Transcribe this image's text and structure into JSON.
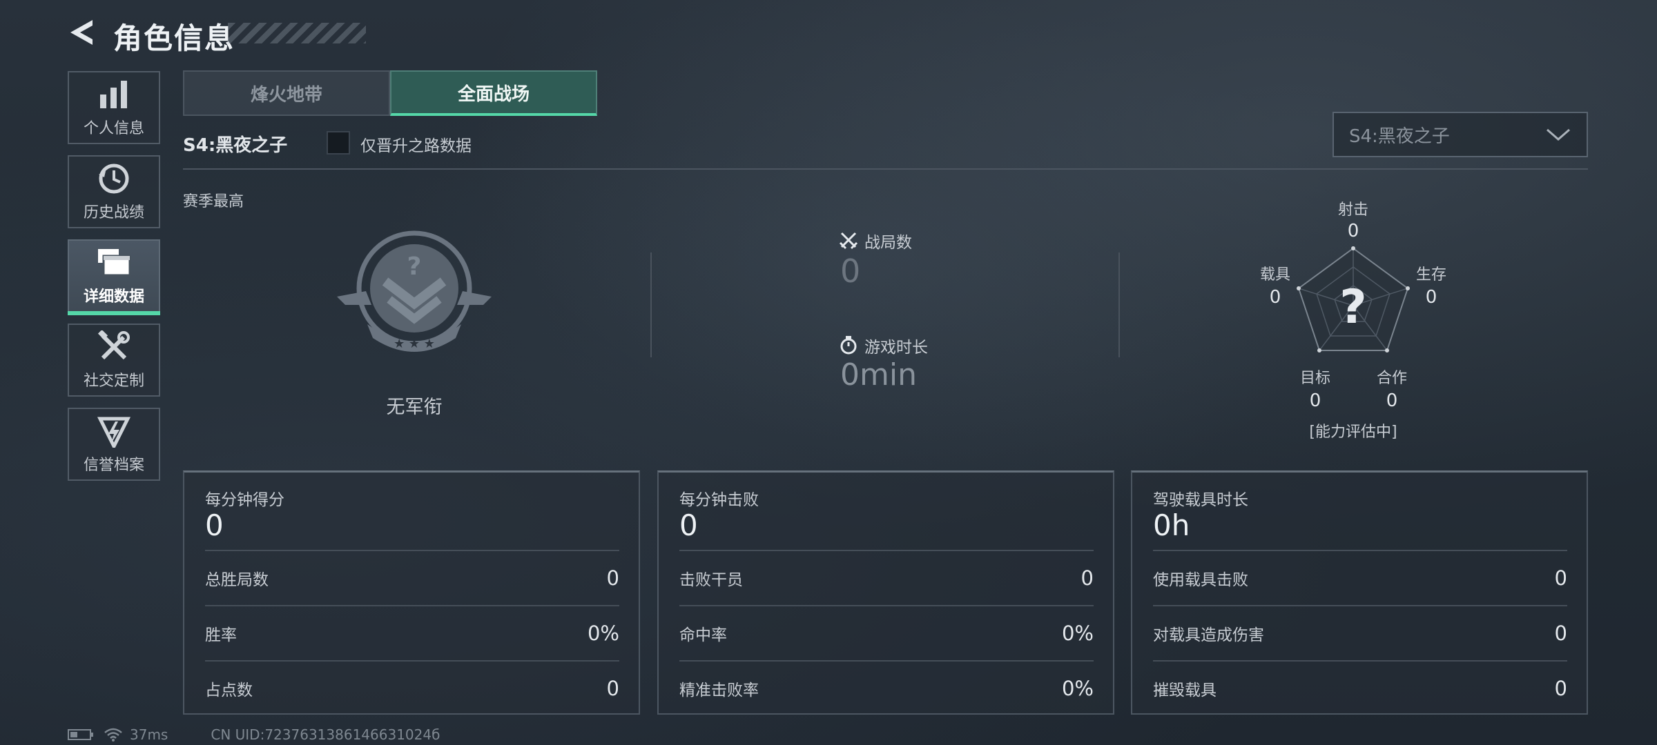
{
  "header": {
    "title": "角色信息"
  },
  "sidebar": {
    "items": [
      {
        "label": "个人信息",
        "icon": "bar-chart-icon"
      },
      {
        "label": "历史战绩",
        "icon": "history-clock-icon"
      },
      {
        "label": "详细数据",
        "icon": "stacked-windows-icon",
        "active": true
      },
      {
        "label": "社交定制",
        "icon": "tools-icon"
      },
      {
        "label": "信誉档案",
        "icon": "credit-emblem-icon"
      }
    ]
  },
  "tabs": [
    {
      "label": "烽火地带",
      "active": false
    },
    {
      "label": "全面战场",
      "active": true
    }
  ],
  "season": {
    "label": "S4:黑夜之子",
    "checkbox_label": "仅晋升之路数据",
    "checkbox_checked": false,
    "dropdown_value": "S4:黑夜之子"
  },
  "best": {
    "label": "赛季最高",
    "rank_label": "无军衔",
    "matches_label": "战局数",
    "matches_value": "0",
    "time_label": "游戏时长",
    "time_value": "0min"
  },
  "radar": {
    "top": {
      "label": "射击",
      "value": "0"
    },
    "right": {
      "label": "生存",
      "value": "0"
    },
    "bottom_right": {
      "label": "合作",
      "value": "0"
    },
    "bottom_left": {
      "label": "目标",
      "value": "0"
    },
    "left": {
      "label": "载具",
      "value": "0"
    },
    "status": "[能力评估中]"
  },
  "panels": [
    {
      "title": "每分钟得分",
      "main": "0",
      "rows": [
        {
          "label": "总胜局数",
          "value": "0"
        },
        {
          "label": "胜率",
          "value": "0%"
        },
        {
          "label": "占点数",
          "value": "0"
        }
      ]
    },
    {
      "title": "每分钟击败",
      "main": "0",
      "rows": [
        {
          "label": "击败干员",
          "value": "0"
        },
        {
          "label": "命中率",
          "value": "0%"
        },
        {
          "label": "精准击败率",
          "value": "0%"
        }
      ]
    },
    {
      "title": "驾驶载具时长",
      "main": "0h",
      "rows": [
        {
          "label": "使用载具击败",
          "value": "0"
        },
        {
          "label": "对载具造成伤害",
          "value": "0"
        },
        {
          "label": "摧毁载具",
          "value": "0"
        }
      ]
    }
  ],
  "footer": {
    "ping": "37ms",
    "uid": "CN UID:7237631386146631024б"
  },
  "colors": {
    "accent": "#55d7a8",
    "tab_active_bg": "#2f5c55"
  }
}
